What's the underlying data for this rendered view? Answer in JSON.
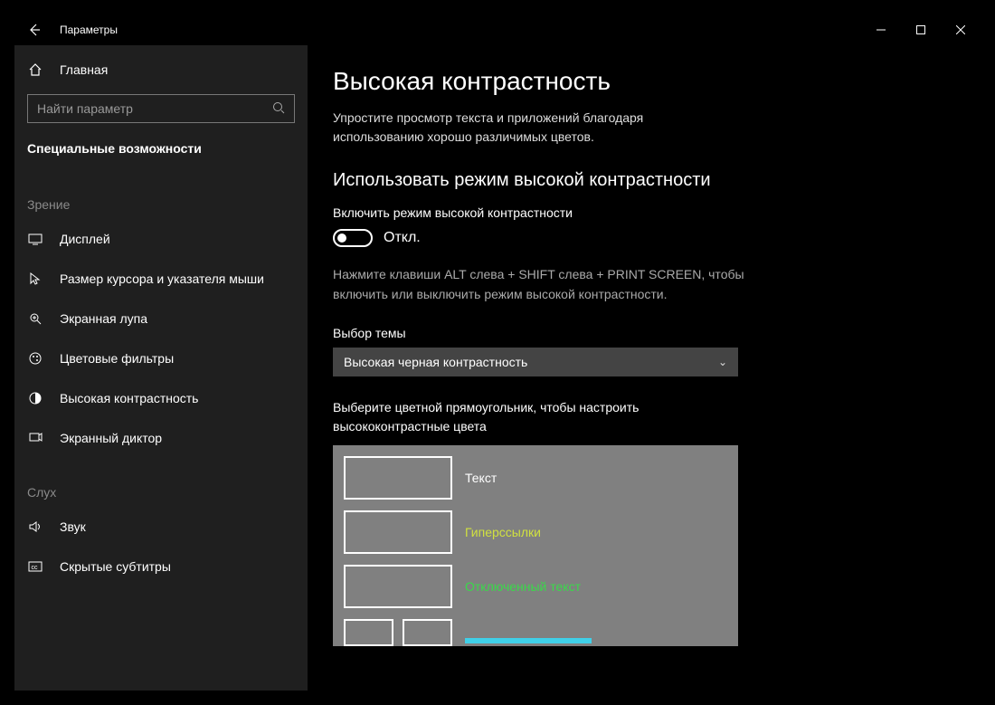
{
  "window": {
    "title": "Параметры"
  },
  "sidebar": {
    "home": "Главная",
    "search_placeholder": "Найти параметр",
    "category": "Специальные возможности",
    "groups": [
      {
        "title": "Зрение",
        "items": [
          {
            "icon": "display-icon",
            "label": "Дисплей"
          },
          {
            "icon": "cursor-icon",
            "label": "Размер курсора и указателя мыши"
          },
          {
            "icon": "magnifier-icon",
            "label": "Экранная лупа"
          },
          {
            "icon": "color-filter-icon",
            "label": "Цветовые фильтры"
          },
          {
            "icon": "contrast-icon",
            "label": "Высокая контрастность"
          },
          {
            "icon": "narrator-icon",
            "label": "Экранный диктор"
          }
        ]
      },
      {
        "title": "Слух",
        "items": [
          {
            "icon": "sound-icon",
            "label": "Звук"
          },
          {
            "icon": "cc-icon",
            "label": "Скрытые субтитры"
          }
        ]
      }
    ]
  },
  "main": {
    "title": "Высокая контрастность",
    "description": "Упростите просмотр текста и приложений благодаря использованию хорошо различимых цветов.",
    "section_use": "Использовать режим высокой контрастности",
    "toggle_label": "Включить режим высокой контрастности",
    "toggle_state": "Откл.",
    "hint": "Нажмите клавиши ALT слева + SHIFT слева + PRINT SCREEN, чтобы включить или выключить режим высокой контрастности.",
    "theme_label": "Выбор темы",
    "theme_value": "Высокая черная контрастность",
    "preview_label": "Выберите цветной прямоугольник, чтобы настроить высококонтрастные цвета",
    "colors": {
      "text": "Текст",
      "hyperlinks": "Гиперссылки",
      "disabled": "Отключенный текст"
    }
  }
}
